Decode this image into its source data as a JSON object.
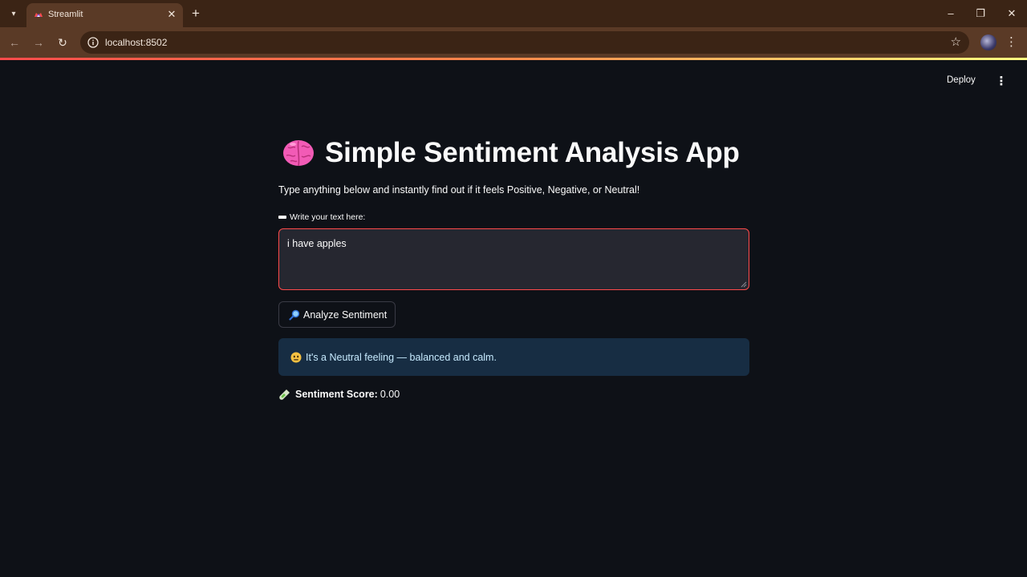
{
  "browser": {
    "tab_title": "Streamlit",
    "url": "localhost:8502"
  },
  "app": {
    "deploy_label": "Deploy",
    "title": "Simple Sentiment Analysis App",
    "subtitle": "Type anything below and instantly find out if it feels Positive, Negative, or Neutral!",
    "input_label": "Write your text here:",
    "input_value": "i have apples",
    "analyze_button_label": "Analyze Sentiment",
    "result_message": "It's a Neutral feeling — balanced and calm.",
    "score_label": "Sentiment Score:",
    "score_value": "0.00"
  },
  "colors": {
    "background": "#0e1117",
    "accent": "#ff4b4b",
    "info_bg": "#172d43",
    "info_text": "#c7ebff",
    "browser_frame": "#5a3a26"
  },
  "icons": {
    "title_icon": "brain-icon",
    "label_icon": "pencil-icon",
    "button_icon": "magnifier-icon",
    "result_icon": "neutral-face-icon",
    "score_icon": "test-tube-icon"
  }
}
